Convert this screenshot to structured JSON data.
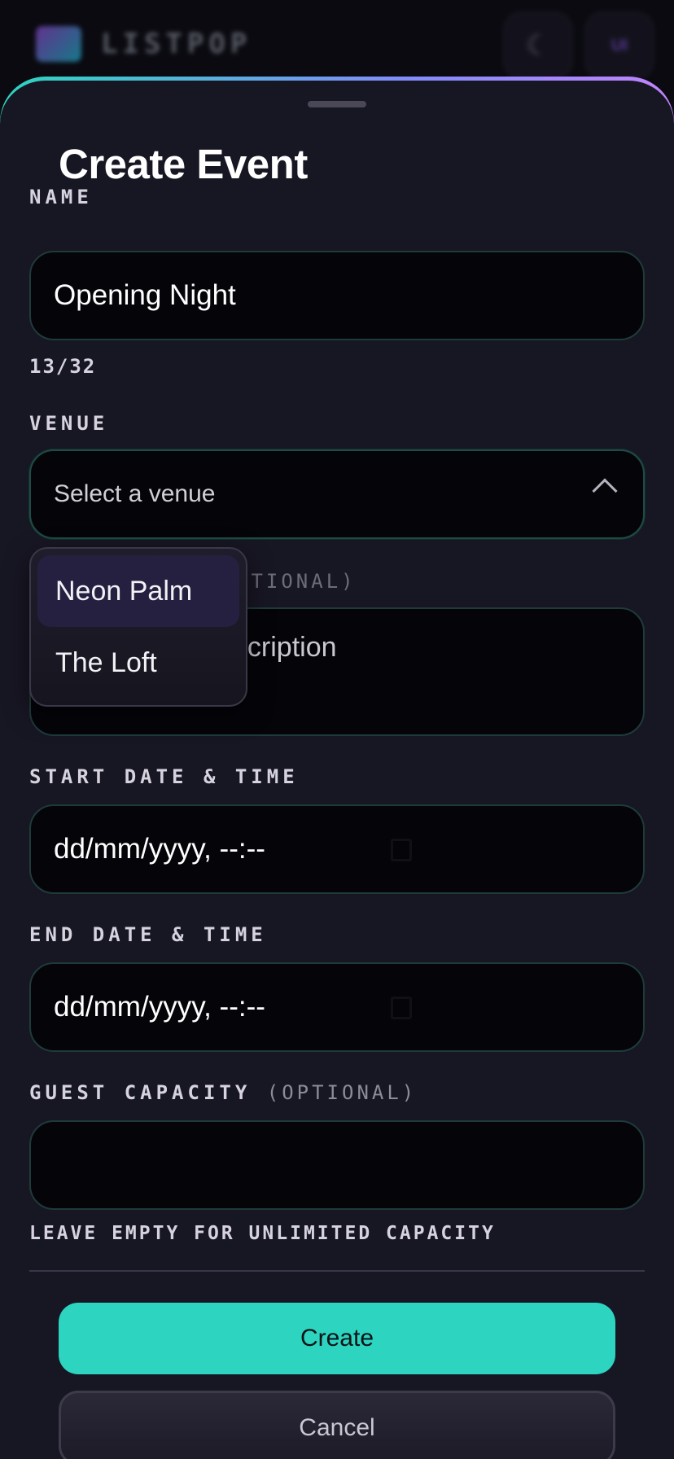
{
  "app": {
    "name": "LISTPOP",
    "user_initials": "UI"
  },
  "sheet": {
    "title": "Create Event",
    "name": {
      "label": "NAME",
      "value": "Opening Night",
      "counter": "13/32"
    },
    "venue": {
      "label": "VENUE",
      "placeholder": "Select a venue",
      "options": [
        "Neon Palm",
        "The Loft"
      ]
    },
    "description": {
      "label_suffix": "PTIONAL)",
      "placeholder_visible": "escription"
    },
    "start": {
      "label": "START DATE & TIME",
      "value": "dd/mm/yyyy, --:--"
    },
    "end": {
      "label": "END DATE & TIME",
      "value": "dd/mm/yyyy, --:--"
    },
    "capacity": {
      "label": "GUEST CAPACITY",
      "label_optional": "(OPTIONAL)",
      "value": "",
      "hint": "LEAVE EMPTY FOR UNLIMITED CAPACITY"
    },
    "actions": {
      "create": "Create",
      "cancel": "Cancel"
    }
  },
  "colors": {
    "accent": "#2dd4bf",
    "sheet_bg": "#171623",
    "field_bg": "#050409"
  }
}
